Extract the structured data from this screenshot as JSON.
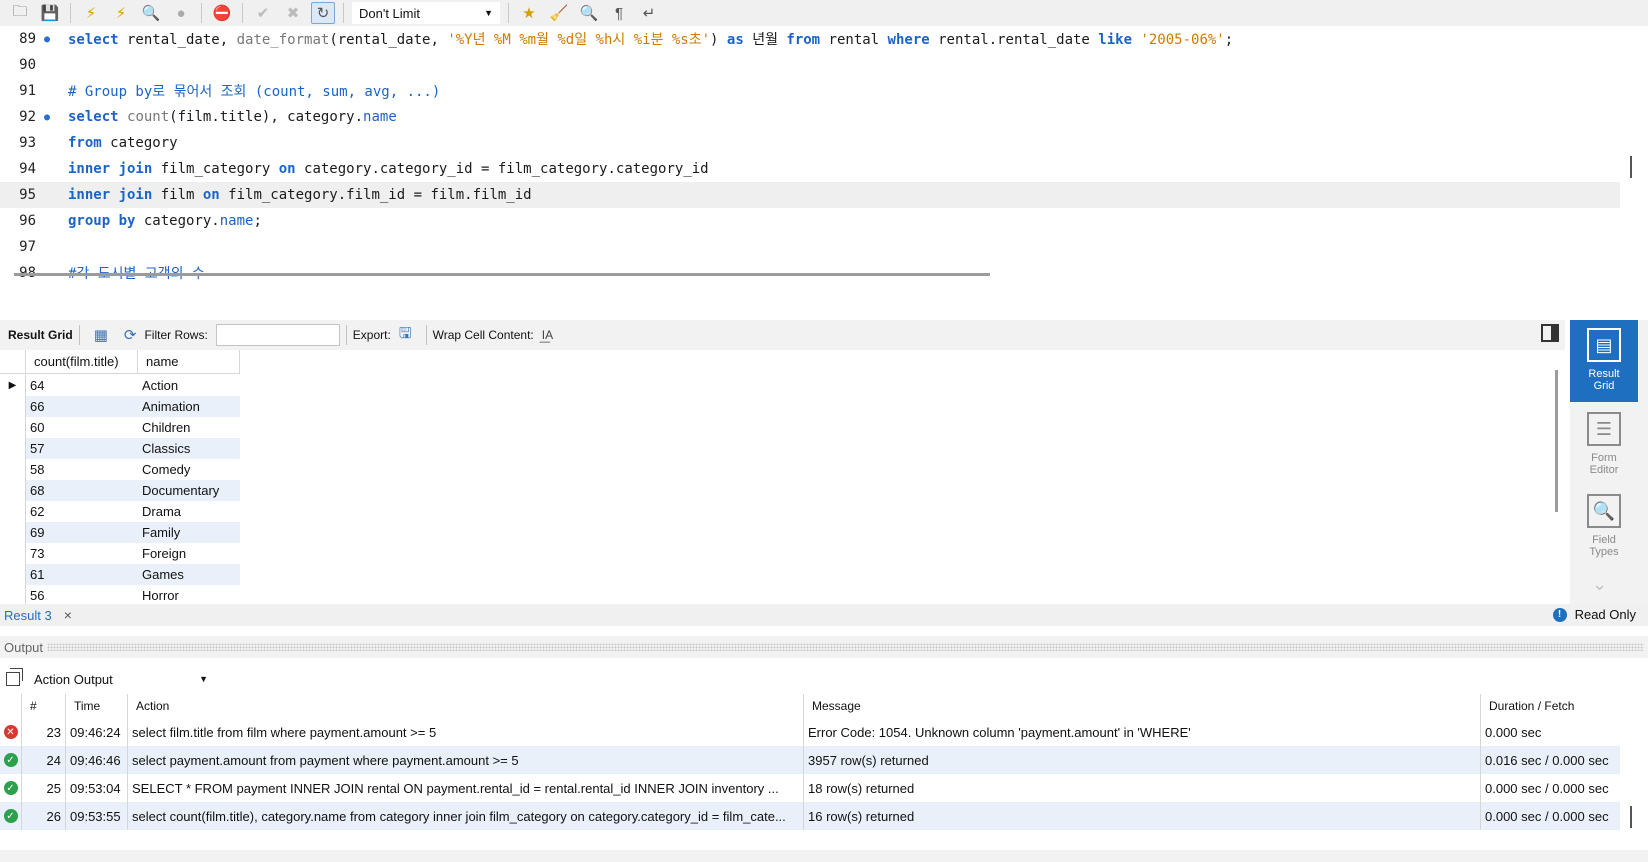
{
  "toolbar": {
    "limit_select": "Don't Limit"
  },
  "editor": {
    "lines": [
      {
        "number": "89",
        "marker": "●"
      },
      {
        "number": "90"
      },
      {
        "number": "91"
      },
      {
        "number": "92",
        "marker": "●"
      },
      {
        "number": "93"
      },
      {
        "number": "94"
      },
      {
        "number": "95"
      },
      {
        "number": "96"
      },
      {
        "number": "97"
      },
      {
        "number": "98"
      }
    ],
    "code": {
      "l89_kw_select": "select",
      "l89_a": " rental_date, ",
      "l89_fn": "date_format",
      "l89_b": "(rental_date, ",
      "l89_str": "'%Y년 %M %m월 %d일 %h시 %i분 %s초'",
      "l89_c": ") ",
      "l89_kw_as": "as",
      "l89_d": " 년월 ",
      "l89_kw_from": "from",
      "l89_e": " rental ",
      "l89_kw_where": "where",
      "l89_f": " rental.rental_date ",
      "l89_kw_like": "like",
      "l89_g": " ",
      "l89_str2": "'2005-06%'",
      "l89_h": ";",
      "l91_comment": "# Group by로 묶어서 조회 (count, sum, avg, ...)",
      "l92_kw_select": "select",
      "l92_a": " ",
      "l92_fn": "count",
      "l92_b": "(film.title), category.",
      "l92_name": "name",
      "l93_kw_from": "from",
      "l93_a": " category",
      "l94_kw_inner": "inner join",
      "l94_a": " film_category ",
      "l94_kw_on": "on",
      "l94_b": " category.category_id = film_category.category_id",
      "l95_kw_inner": "inner join",
      "l95_a": " film ",
      "l95_kw_on": "on",
      "l95_b": " film_category.film_id = film.film_id",
      "l96_kw_group": "group by",
      "l96_a": " category.",
      "l96_name": "name",
      "l96_b": ";",
      "l98_comment": "#각 도시별 고객의 수"
    }
  },
  "result_toolbar": {
    "result_grid_label": "Result Grid",
    "filter_rows_label": "Filter Rows:",
    "filter_value": "",
    "export_label": "Export:",
    "wrap_label": "Wrap Cell Content:"
  },
  "grid": {
    "columns": [
      "count(film.title)",
      "name"
    ],
    "rows": [
      [
        "64",
        "Action"
      ],
      [
        "66",
        "Animation"
      ],
      [
        "60",
        "Children"
      ],
      [
        "57",
        "Classics"
      ],
      [
        "58",
        "Comedy"
      ],
      [
        "68",
        "Documentary"
      ],
      [
        "62",
        "Drama"
      ],
      [
        "69",
        "Family"
      ],
      [
        "73",
        "Foreign"
      ],
      [
        "61",
        "Games"
      ],
      [
        "56",
        "Horror"
      ]
    ]
  },
  "side_panel": {
    "items": [
      {
        "label_line1": "Result",
        "label_line2": "Grid"
      },
      {
        "label_line1": "Form",
        "label_line2": "Editor"
      },
      {
        "label_line1": "Field",
        "label_line2": "Types"
      }
    ]
  },
  "result_tabs": {
    "tab_label": "Result 3",
    "read_only_label": "Read Only"
  },
  "output": {
    "header_label": "Output",
    "select_value": "Action Output",
    "columns": [
      "#",
      "Time",
      "Action",
      "Message",
      "Duration / Fetch"
    ],
    "rows": [
      {
        "status": "error",
        "num": "23",
        "time": "09:46:24",
        "action": "select film.title from film where payment.amount >= 5",
        "message": "Error Code: 1054. Unknown column 'payment.amount' in 'WHERE'",
        "duration": "0.000 sec"
      },
      {
        "status": "ok",
        "num": "24",
        "time": "09:46:46",
        "action": "select payment.amount from payment where payment.amount >= 5",
        "message": "3957 row(s) returned",
        "duration": "0.016 sec / 0.000 sec"
      },
      {
        "status": "ok",
        "num": "25",
        "time": "09:53:04",
        "action": "SELECT * FROM payment INNER JOIN rental ON payment.rental_id = rental.rental_id INNER JOIN inventory ...",
        "message": "18 row(s) returned",
        "duration": "0.000 sec / 0.000 sec"
      },
      {
        "status": "ok",
        "num": "26",
        "time": "09:53:55",
        "action": "select count(film.title), category.name from category inner join film_category on category.category_id = film_cate...",
        "message": "16 row(s) returned",
        "duration": "0.000 sec / 0.000 sec"
      }
    ]
  }
}
